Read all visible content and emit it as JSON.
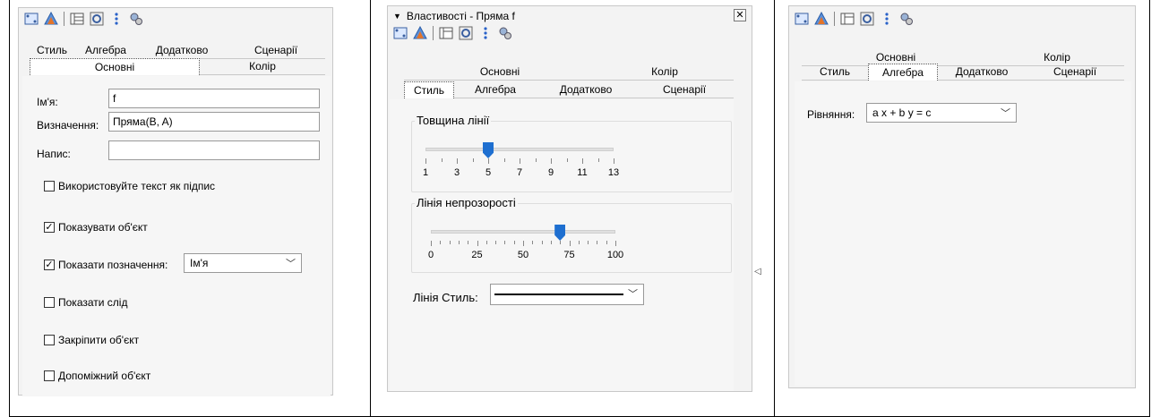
{
  "left": {
    "tabs_row1": [
      "Стиль",
      "Алгебра",
      "Додатково",
      "Сценарії"
    ],
    "tabs_row2": [
      "Основні",
      "Колір"
    ],
    "name_label": "Ім'я:",
    "name_value": "f",
    "def_label": "Визначення:",
    "def_value": "Пряма(B, A)",
    "caption_label": "Напис:",
    "caption_value": "",
    "use_text_caption": "Використовуйте текст як підпис",
    "show_object": "Показувати об'єкт",
    "show_label": "Показати позначення:",
    "show_label_select": "Ім'я",
    "show_trace": "Показати слід",
    "fix_object": "Закріпити об'єкт",
    "aux_object": "Допоміжний об'єкт"
  },
  "middle": {
    "title": "Властивості - Пряма f",
    "tabs_row1": [
      "Основні",
      "Колір"
    ],
    "tabs_row2": [
      "Стиль",
      "Алгебра",
      "Додатково",
      "Сценарії"
    ],
    "thickness_title": "Товщина лінії",
    "thickness_value": 5,
    "thickness_ticks": [
      "1",
      "3",
      "5",
      "7",
      "9",
      "11",
      "13"
    ],
    "opacity_title": "Лінія непрозорості",
    "opacity_value": 70,
    "opacity_ticks": [
      "0",
      "25",
      "50",
      "75",
      "100"
    ],
    "line_style_label": "Лінія Стиль:"
  },
  "right": {
    "tabs_row1": [
      "Основні",
      "Колір"
    ],
    "tabs_row2": [
      "Стиль",
      "Алгебра",
      "Додатково",
      "Сценарії"
    ],
    "equation_label": "Рівняння:",
    "equation_value": "a x + b y = c"
  }
}
